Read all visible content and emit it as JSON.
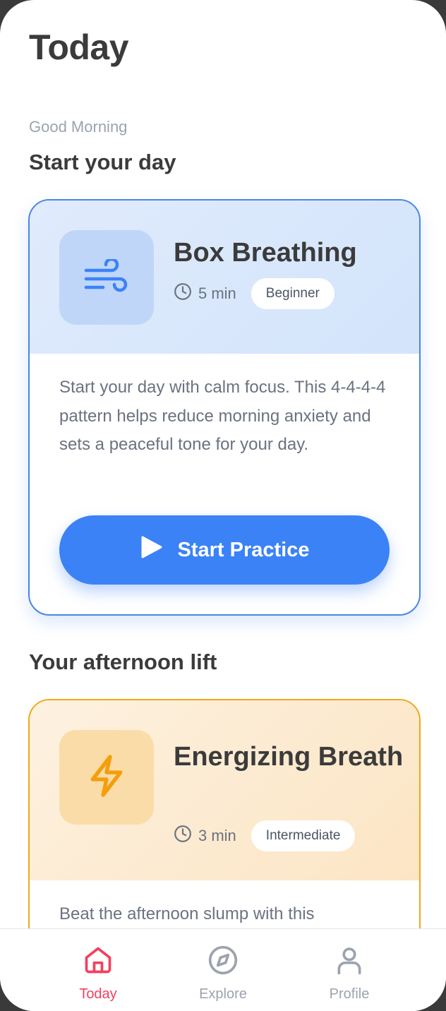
{
  "header": {
    "title": "Today"
  },
  "greeting": "Good Morning",
  "sections": [
    {
      "title": "Start your day",
      "card": {
        "name": "Box Breathing",
        "icon": "wind-icon",
        "duration": "5 min",
        "level": "Beginner",
        "description": "Start your day with calm focus. This 4-4-4-4 pattern helps reduce morning anxiety and sets a peaceful tone for your day.",
        "cta_label": "Start Practice",
        "accent": "#3b82f6"
      }
    },
    {
      "title": "Your afternoon lift",
      "card": {
        "name": "Energizing Breath",
        "icon": "lightning-icon",
        "duration": "3 min",
        "level": "Intermediate",
        "description": "Beat the afternoon slump with this",
        "accent": "#f59e0b"
      }
    }
  ],
  "tabbar": {
    "active_color": "#f43f5e",
    "items": [
      {
        "label": "Today",
        "icon": "home-icon",
        "active": true
      },
      {
        "label": "Explore",
        "icon": "compass-icon",
        "active": false
      },
      {
        "label": "Profile",
        "icon": "user-icon",
        "active": false
      }
    ]
  }
}
